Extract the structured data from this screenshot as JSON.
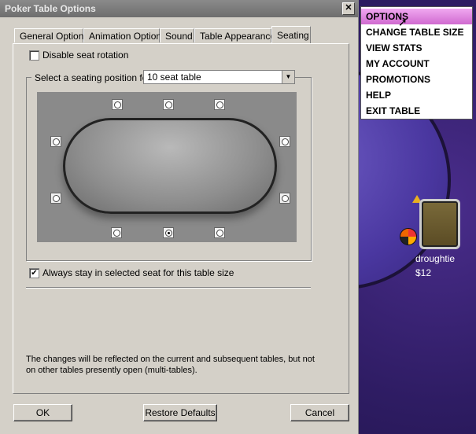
{
  "dialog": {
    "title": "Poker Table Options",
    "close_glyph": "✕",
    "tabs": [
      {
        "label": "General Options"
      },
      {
        "label": "Animation Options"
      },
      {
        "label": "Sound"
      },
      {
        "label": "Table Appearance"
      },
      {
        "label": "Seating"
      }
    ],
    "selected_tab": "Seating",
    "disable_rotation_label": "Disable seat rotation",
    "disable_rotation_checked": false,
    "select_label": "Select a seating position for",
    "select_value": "10 seat table",
    "select_arrow": "▼",
    "always_stay_label": "Always stay in selected seat for this table size",
    "always_stay_checked": true,
    "always_stay_mark": "✔",
    "note": "The changes will be reflected on the current and subsequent tables, but not on other tables presently open (multi-tables).",
    "buttons": {
      "ok": "OK",
      "restore": "Restore Defaults",
      "cancel": "Cancel"
    },
    "selected_seat": "bottom-2"
  },
  "menu": {
    "items": [
      {
        "label": "OPTIONS",
        "active": true
      },
      {
        "label": "CHANGE TABLE SIZE",
        "active": false
      },
      {
        "label": "VIEW STATS",
        "active": false
      },
      {
        "label": "MY ACCOUNT",
        "active": false
      },
      {
        "label": "PROMOTIONS",
        "active": false
      },
      {
        "label": "HELP",
        "active": false
      },
      {
        "label": "EXIT TABLE",
        "active": false
      }
    ],
    "cursor_glyph": "➚"
  },
  "player": {
    "name": "droughtie",
    "stack": "$12"
  },
  "colors": {
    "menu_highlight": "#d06ad0",
    "background": "#2e1c63",
    "dialog": "#d4d0c8"
  }
}
